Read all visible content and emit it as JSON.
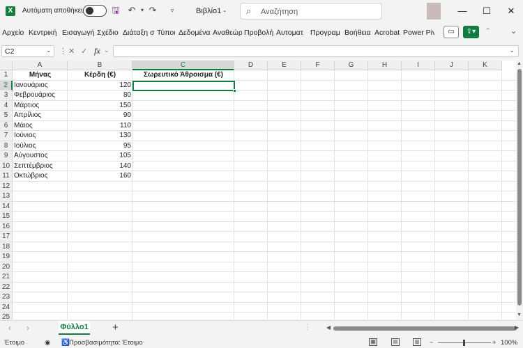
{
  "titlebar": {
    "app_icon": "excel-logo",
    "app_letter": "X",
    "autosave_label": "Αυτόματη αποθήκευση",
    "autosave_on": false,
    "doc_title": "Βιβλίο1  -",
    "search_placeholder": "Αναζήτηση",
    "window_controls": [
      "minimize",
      "maximize",
      "close"
    ]
  },
  "menu": {
    "items": [
      "Αρχείο",
      "Κεντρική",
      "Εισαγωγή",
      "Σχέδιο",
      "Διάταξη σ",
      "Τύποι",
      "Δεδομένα",
      "Αναθεώρ",
      "Προβολή",
      "Αυτοματ",
      "Προγραμ",
      "Βοήθεια",
      "Acrobat",
      "Power Piv"
    ]
  },
  "formula_bar": {
    "name_box": "C2",
    "formula": "",
    "fx_label": "fx"
  },
  "colors": {
    "accent": "#107c41",
    "grid_line": "#e1e1e1",
    "header_bg": "#efefef"
  },
  "sheet": {
    "columns": [
      "A",
      "B",
      "C",
      "D",
      "E",
      "F",
      "G",
      "H",
      "I",
      "J",
      "K"
    ],
    "selected_column": "C",
    "selected_row": 2,
    "rows": [
      "1",
      "2",
      "3",
      "4",
      "5",
      "6",
      "7",
      "8",
      "9",
      "10",
      "11",
      "12",
      "13",
      "14",
      "15",
      "16",
      "17",
      "18",
      "19",
      "20",
      "21",
      "22",
      "23",
      "24",
      "25"
    ],
    "headers": [
      "Μήνας",
      "Κέρδη (€)",
      "Σωρευτικό Άθροισμα (€)"
    ],
    "data": [
      {
        "month": "Ιανουάριος",
        "profit": "120"
      },
      {
        "month": "Φεβρουάριος",
        "profit": "80"
      },
      {
        "month": "Μάρτιος",
        "profit": "150"
      },
      {
        "month": "Απρίλιος",
        "profit": "90"
      },
      {
        "month": "Μάιος",
        "profit": "110"
      },
      {
        "month": "Ιούνιος",
        "profit": "130"
      },
      {
        "month": "Ιούλιος",
        "profit": "95"
      },
      {
        "month": "Αύγουστος",
        "profit": "105"
      },
      {
        "month": "Σεπτέμβριος",
        "profit": "140"
      },
      {
        "month": "Οκτώβριος",
        "profit": "160"
      }
    ]
  },
  "tabs": {
    "sheets": [
      "Φύλλο1"
    ],
    "add_label": "+"
  },
  "status": {
    "ready": "Έτοιμο",
    "accessibility": "Προσβασιμότητα: Έτοιμο",
    "zoom": "100%",
    "zoom_minus": "−",
    "zoom_plus": "+"
  }
}
